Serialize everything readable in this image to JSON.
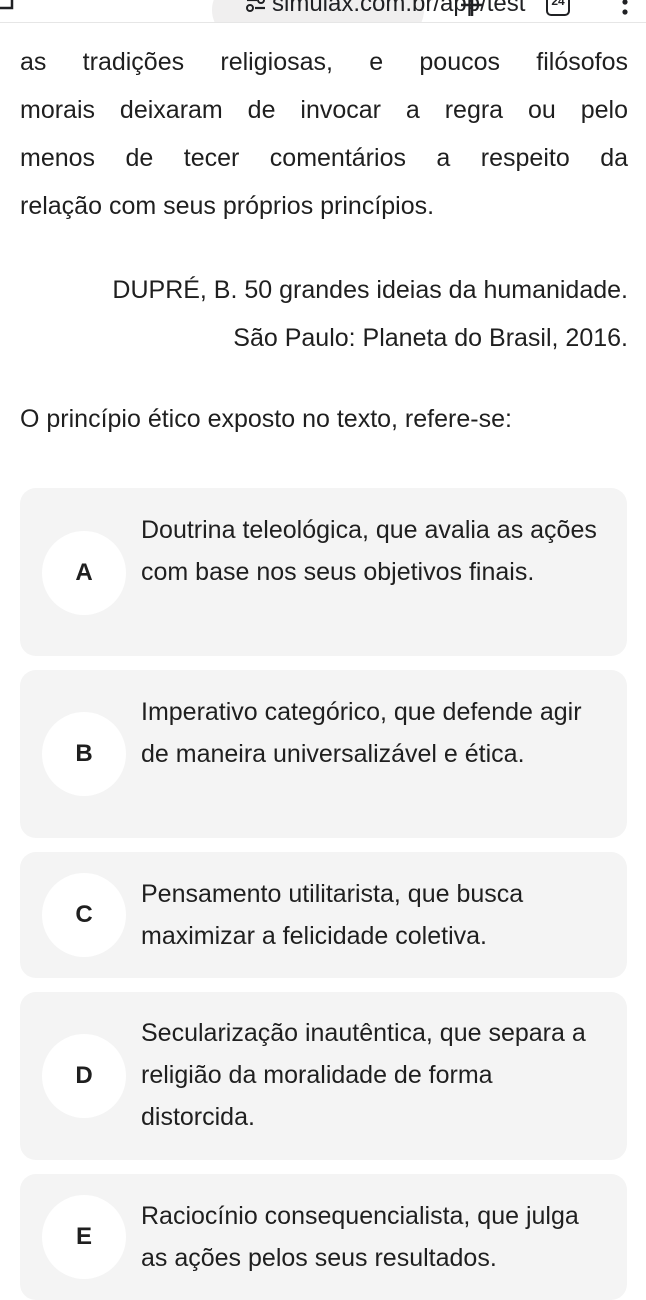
{
  "browser": {
    "url": "simulax.com.br/app/test",
    "tab_count": "24",
    "icons": [
      "home-icon",
      "site-settings-icon",
      "new-tab-icon",
      "tab-count-icon",
      "menu-icon"
    ]
  },
  "passage": {
    "lines": [
      "as tradições religiosas, e poucos filósofos",
      "morais deixaram de invocar a regra ou pelo",
      "menos de tecer comentários a respeito da",
      "relação com seus próprios princípios."
    ]
  },
  "citation": {
    "line1": "DUPRÉ, B. 50 grandes ideias da humanidade.",
    "line2": "São Paulo: Planeta do Brasil, 2016."
  },
  "question": "O princípio ético exposto no texto, refere-se:",
  "options": [
    {
      "letter": "A",
      "text": "Doutrina teleológica, que avalia as ações com base nos seus objetivos finais."
    },
    {
      "letter": "B",
      "text": "Imperativo categórico, que defende agir de maneira universalizável e ética."
    },
    {
      "letter": "C",
      "text": "Pensamento utilitarista, que busca maximizar a felicidade coletiva."
    },
    {
      "letter": "D",
      "text": "Secularização inautêntica, que separa a religião da moralidade de forma distorcida."
    },
    {
      "letter": "E",
      "text": "Raciocínio consequencialista, que julga as ações pelos seus resultados."
    }
  ],
  "colors": {
    "option_background": "#f4f4f4",
    "letter_circle": "#ffffff",
    "text": "#1f1f1f",
    "url_pill": "#f0efef"
  }
}
